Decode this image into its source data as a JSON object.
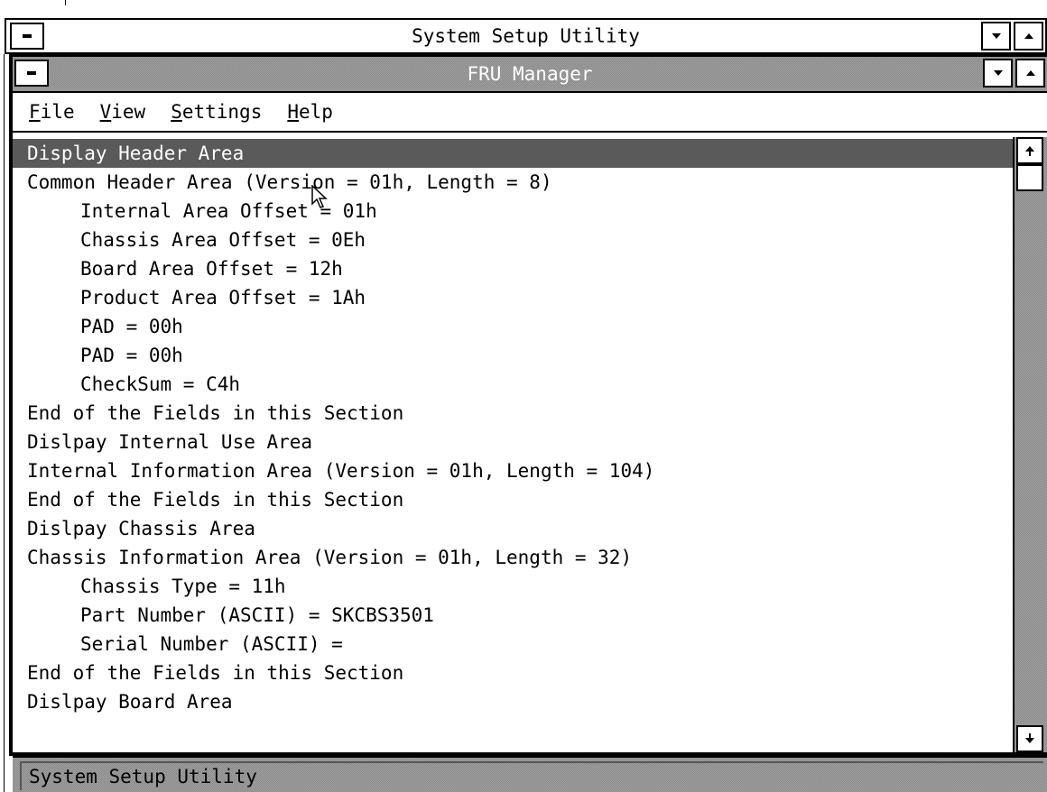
{
  "outer_window": {
    "title": "System Setup Utility"
  },
  "inner_window": {
    "title": "FRU Manager"
  },
  "menu": {
    "items": [
      {
        "mnemonic": "F",
        "rest": "ile"
      },
      {
        "mnemonic": "V",
        "rest": "iew"
      },
      {
        "mnemonic": "S",
        "rest": "ettings"
      },
      {
        "mnemonic": "H",
        "rest": "elp"
      }
    ]
  },
  "list": {
    "selected_index": 0,
    "rows": [
      {
        "text": "Display Header Area",
        "indent": 0
      },
      {
        "text": "Common Header Area (Version = 01h, Length = 8)",
        "indent": 0
      },
      {
        "text": "Internal Area Offset = 01h",
        "indent": 1
      },
      {
        "text": "Chassis Area Offset = 0Eh",
        "indent": 1
      },
      {
        "text": "Board Area Offset = 12h",
        "indent": 1
      },
      {
        "text": "Product Area Offset = 1Ah",
        "indent": 1
      },
      {
        "text": "PAD = 00h",
        "indent": 1
      },
      {
        "text": "PAD = 00h",
        "indent": 1
      },
      {
        "text": "CheckSum = C4h",
        "indent": 1
      },
      {
        "text": "End of the Fields in this Section",
        "indent": 0
      },
      {
        "text": "Dislpay Internal Use Area",
        "indent": 0
      },
      {
        "text": "Internal Information Area (Version = 01h, Length = 104)",
        "indent": 0
      },
      {
        "text": "End of the Fields in this Section",
        "indent": 0
      },
      {
        "text": "Dislpay Chassis Area",
        "indent": 0
      },
      {
        "text": "Chassis Information Area (Version = 01h, Length = 32)",
        "indent": 0
      },
      {
        "text": "Chassis Type = 11h",
        "indent": 1
      },
      {
        "text": "Part Number (ASCII) = SKCBS3501",
        "indent": 1
      },
      {
        "text": "Serial Number (ASCII) =",
        "indent": 1
      },
      {
        "text": "End of the Fields in this Section",
        "indent": 0
      },
      {
        "text": "Dislpay Board Area",
        "indent": 0
      }
    ]
  },
  "statusbar": {
    "text": "System Setup Utility"
  },
  "icons": {
    "system_menu": "system-menu-icon",
    "minimize": "minimize-arrow-icon",
    "maximize": "maximize-arrow-icon",
    "scroll_up": "scroll-up-arrow-icon",
    "scroll_down": "scroll-down-arrow-icon",
    "mouse_pointer": "mouse-pointer-icon"
  },
  "colors": {
    "selection": "#5a5a5a",
    "active_titlebar_dither": "#8a8a8a",
    "window_background": "#ffffff",
    "text": "#000000"
  }
}
